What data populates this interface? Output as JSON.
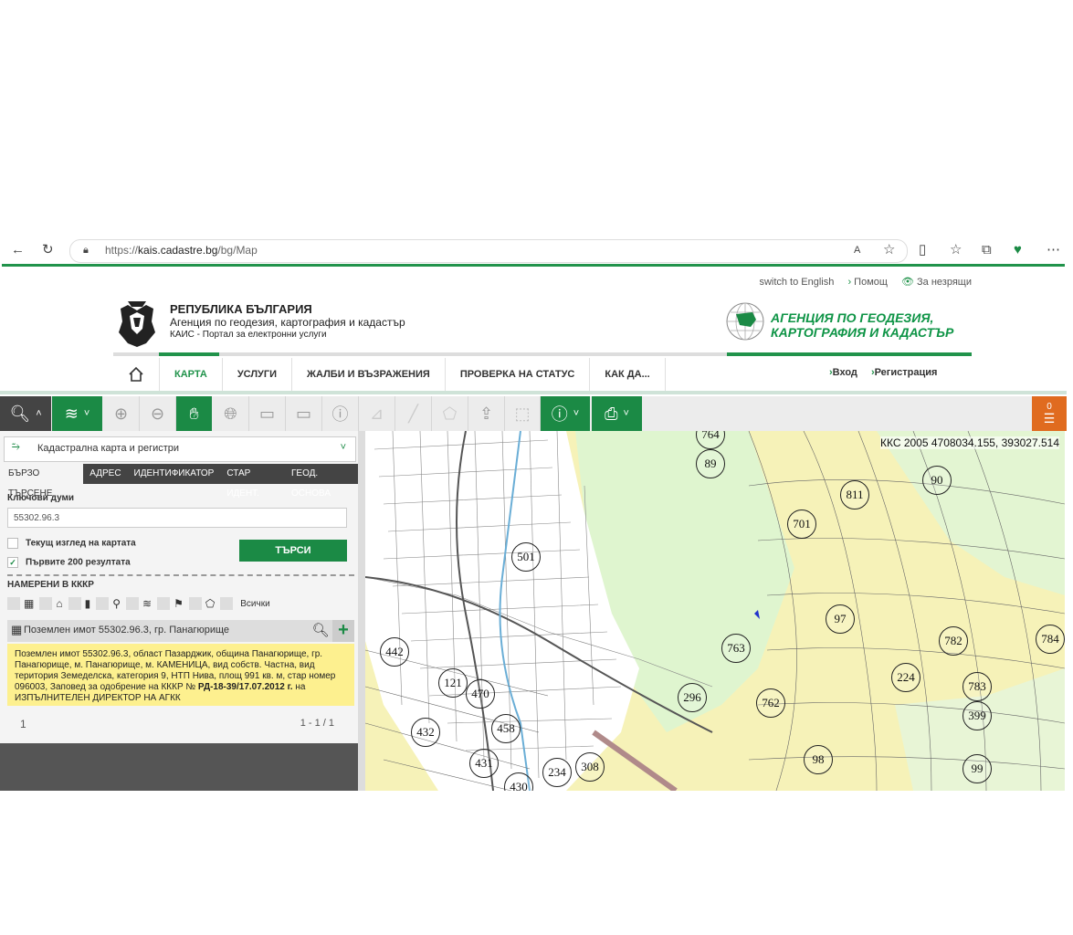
{
  "browser": {
    "url_prefix": "https://",
    "url_domain": "kais.cadastre.bg",
    "url_path": "/bg/Map"
  },
  "header": {
    "links": [
      "switch to English",
      "Помощ",
      "За незрящи"
    ],
    "title_line1": "РЕПУБЛИКА БЪЛГАРИЯ",
    "title_line2": "Агенция по геодезия, картография и кадастър",
    "title_line3": "КАИС - Портал за електронни услуги",
    "logo_line1": "Агенция по геодезия,",
    "logo_line2": "картография и кадастър",
    "nav": [
      "КАРТА",
      "УСЛУГИ",
      "ЖАЛБИ И ВЪЗРАЖЕНИЯ",
      "ПРОВЕРКА НА СТАТУС",
      "КАК ДА..."
    ],
    "login": "Вход",
    "register": "Регистрация",
    "accent": "#21934b"
  },
  "toolbar": {
    "basket_count": "0"
  },
  "panel": {
    "layer": "Кадастрална карта и регистри",
    "tabs": [
      "БЪРЗО ТЪРСЕНЕ",
      "АДРЕС",
      "ИДЕНТИФИКАТОР",
      "СТАР ИДЕНТ.",
      "ГЕОД. ОСНОВА"
    ],
    "keywords_label": "Ключови думи",
    "keywords_value": "55302.96.3",
    "chk_current_view": "Текущ изглед на картата",
    "chk_first200": "Първите 200 резултата",
    "search_button": "ТЪРСИ",
    "found_label": "НАМЕРЕНИ В КККР",
    "all_label": "Всички",
    "result_title": "Поземлен имот 55302.96.3, гр. Панагюрище",
    "result_desc_a": "Поземлен имот 55302.96.3, област Пазарджик, община Панагюрище, гр. Панагюрище, м. Панагюрище, м. КАМЕНИЦА, вид собств. Частна, вид територия Земеделска, категория 9, НТП Нива, площ 991 кв. м, стар номер 096003, Заповед за одобрение на КККР №",
    "result_desc_b": "РД-18-39/17.07.2012 г.",
    "result_desc_c": "на ИЗПЪЛНИТЕЛЕН ДИРЕКТОР НА АГКК",
    "page": "1",
    "count": "1 - 1 / 1"
  },
  "map": {
    "coordinates": "ККС 2005 4708034.155, 393027.514",
    "parcels": [
      "764",
      "89",
      "90",
      "811",
      "701",
      "501",
      "97",
      "784",
      "442",
      "763",
      "782",
      "224",
      "121",
      "470",
      "296",
      "762",
      "783",
      "399",
      "432",
      "458",
      "98",
      "431",
      "308",
      "234",
      "99",
      "430"
    ]
  }
}
